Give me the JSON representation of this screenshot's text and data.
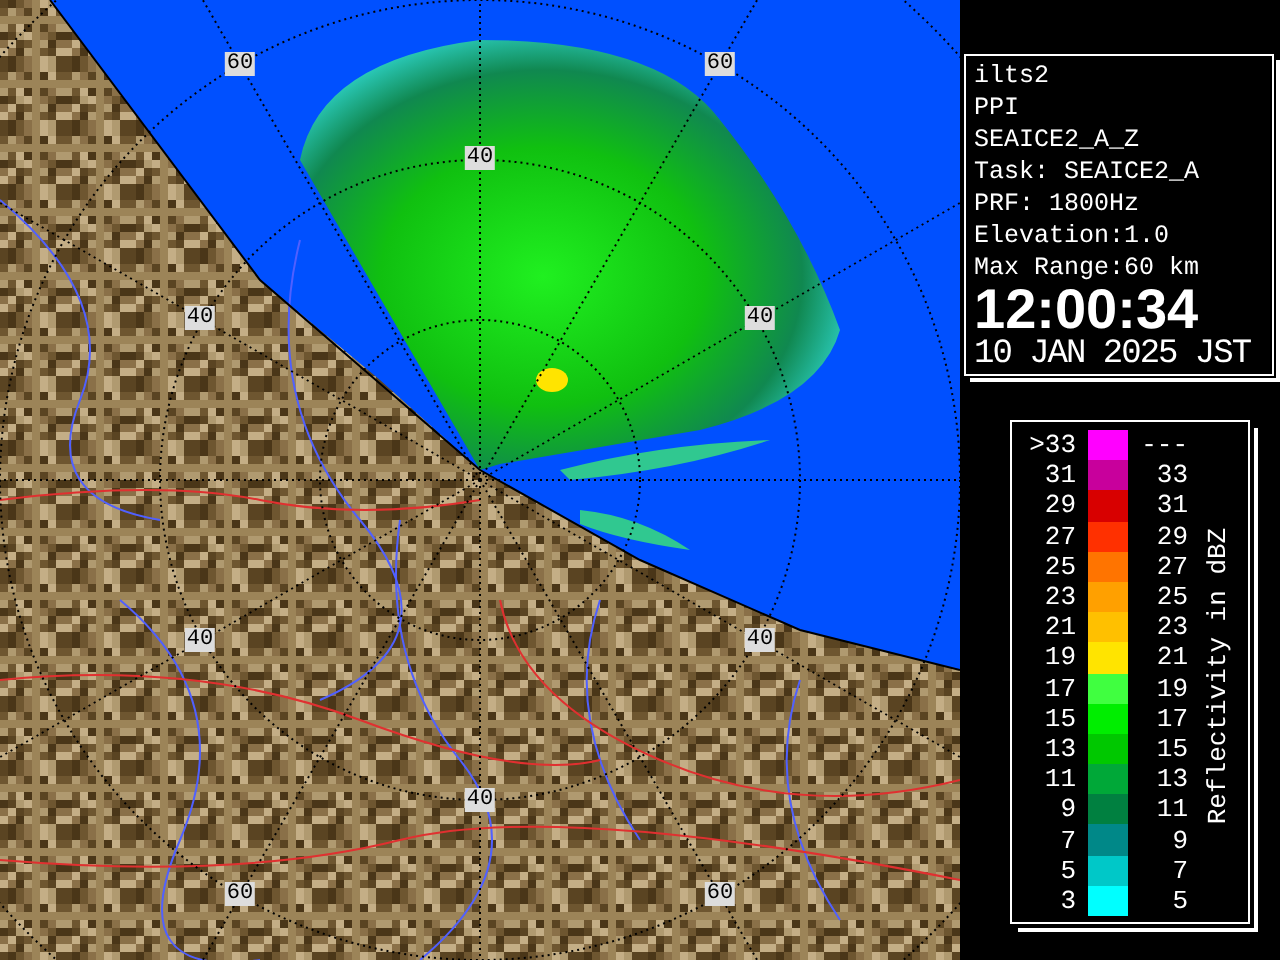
{
  "map": {
    "range_labels": [
      {
        "text": "60"
      },
      {
        "text": "60"
      },
      {
        "text": "40"
      },
      {
        "text": "40"
      },
      {
        "text": "40"
      },
      {
        "text": "40"
      },
      {
        "text": "40"
      },
      {
        "text": "40"
      },
      {
        "text": "60"
      },
      {
        "text": "60"
      }
    ]
  },
  "info": {
    "lines": [
      "ilts2",
      "PPI",
      "SEAICE2_A_Z",
      "Task: SEAICE2_A",
      "PRF: 1800Hz",
      "Elevation:1.0",
      "Max Range:60 km"
    ],
    "time": "12:00:34",
    "date": "10 JAN 2025 JST"
  },
  "legend": {
    "title": "Reflectivity in dBZ",
    "bins": [
      {
        "low": ">33",
        "high": "---",
        "color": "#ff00ff"
      },
      {
        "low": "31",
        "high": "33",
        "color": "#c8009c"
      },
      {
        "low": "29",
        "high": "31",
        "color": "#d80000"
      },
      {
        "low": "27",
        "high": "29",
        "color": "#ff3000"
      },
      {
        "low": "25",
        "high": "27",
        "color": "#ff7400"
      },
      {
        "low": "23",
        "high": "25",
        "color": "#ffa000"
      },
      {
        "low": "21",
        "high": "23",
        "color": "#ffc000"
      },
      {
        "low": "19",
        "high": "21",
        "color": "#ffe400"
      },
      {
        "low": "17",
        "high": "19",
        "color": "#40ff40"
      },
      {
        "low": "15",
        "high": "17",
        "color": "#00ee00"
      },
      {
        "low": "13",
        "high": "15",
        "color": "#00c800"
      },
      {
        "low": "11",
        "high": "13",
        "color": "#00a838"
      },
      {
        "low": "9",
        "high": "11",
        "color": "#008040"
      },
      {
        "low": "7",
        "high": "9",
        "color": "#008888"
      },
      {
        "low": "5",
        "high": "7",
        "color": "#00c8c8"
      },
      {
        "low": "3",
        "high": "5",
        "color": "#00ffff"
      }
    ]
  }
}
